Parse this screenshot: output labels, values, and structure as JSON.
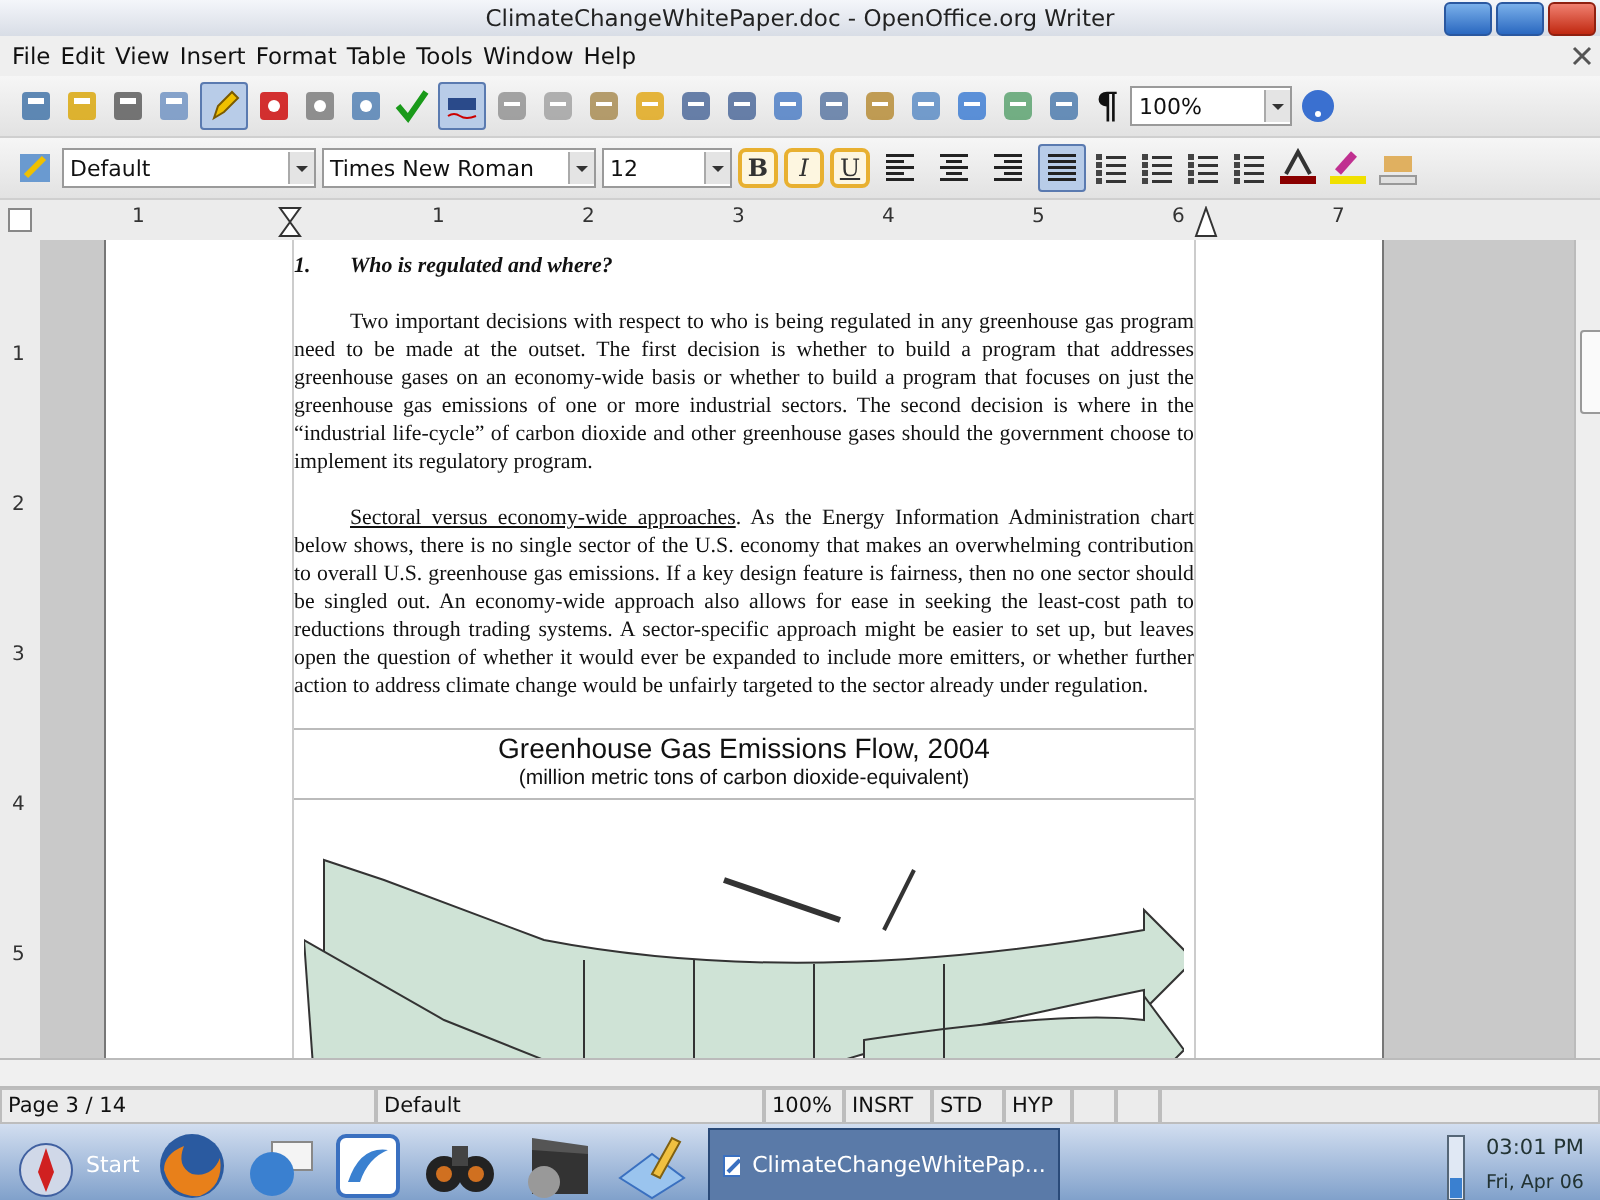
{
  "window": {
    "title": "ClimateChangeWhitePaper.doc - OpenOffice.org Writer"
  },
  "menu": [
    "File",
    "Edit",
    "View",
    "Insert",
    "Format",
    "Table",
    "Tools",
    "Window",
    "Help"
  ],
  "standard_toolbar": {
    "edit_mode_on": true,
    "autospell_on": true,
    "pilcrow": "¶",
    "zoom": "100%"
  },
  "formatting_toolbar": {
    "paragraph_style": "Default",
    "font": "Times New Roman",
    "size": "12",
    "format_buttons": [
      {
        "label": "B",
        "kind": "bold",
        "selected": false
      },
      {
        "label": "I",
        "kind": "italic",
        "selected": false
      },
      {
        "label": "U",
        "kind": "underline",
        "selected": false
      }
    ],
    "alignment": [
      {
        "kind": "left",
        "selected": false
      },
      {
        "kind": "center",
        "selected": false
      },
      {
        "kind": "right",
        "selected": false
      },
      {
        "kind": "justify",
        "selected": true
      }
    ]
  },
  "ruler": {
    "labels": [
      "1",
      "1",
      "2",
      "3",
      "4",
      "5",
      "6",
      "7"
    ]
  },
  "vertical_ruler": {
    "labels": [
      "1",
      "2",
      "3",
      "4",
      "5"
    ]
  },
  "document": {
    "heading_number": "1.",
    "heading": "Who is regulated and where?",
    "paragraphs": [
      {
        "text": "Two important decisions with respect to who is being regulated in any greenhouse gas program need to be made at the outset.  The first decision is whether to build a program that addresses greenhouse gases on an economy-wide basis or whether to build a program that focuses on just the greenhouse gas emissions of one or more industrial sectors.  The second decision is where in the “industrial life-cycle” of carbon dioxide and other greenhouse gases should the government choose to implement its regulatory program."
      },
      {
        "lead": "Sectoral versus economy-wide approaches",
        "text": ".  As the Energy Information Administration chart below shows, there is no single sector of the U.S. economy that makes an overwhelming contribution to overall U.S. greenhouse gas emissions.  If a key design feature is fairness, then no one sector should be singled out.  An economy-wide approach also allows for ease in seeking the least-cost path to reductions through trading systems.  A sector-specific approach might be easier to set up, but leaves open the question of whether it would ever be expanded to include more emitters, or whether further action to address climate change would be unfairly targeted to the sector already under regulation."
      }
    ],
    "figure": {
      "title": "Greenhouse Gas Emissions Flow, 2004",
      "subtitle": "(million metric tons of carbon dioxide-equivalent)"
    }
  },
  "status_bar": {
    "page": "Page 3 / 14",
    "style": "Default",
    "zoom": "100%",
    "insert_mode": "INSRT",
    "selection_mode": "STD",
    "hyperlink_mode": "HYP"
  },
  "taskbar": {
    "start": "Start",
    "window_button": {
      "label": "ClimateChangeWhitePap...",
      "selected": true
    },
    "time": "03:01 PM",
    "date": "Fri, Apr 06"
  }
}
